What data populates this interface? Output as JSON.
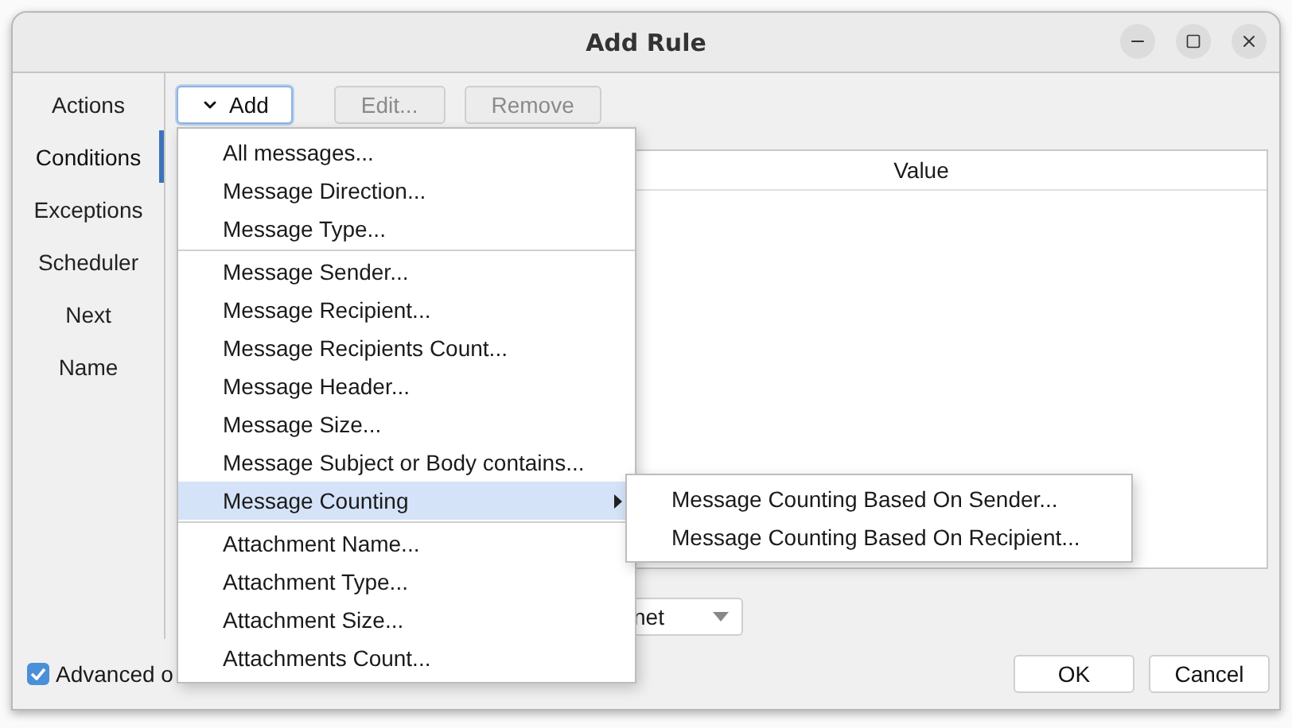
{
  "window": {
    "title": "Add Rule"
  },
  "nav": [
    {
      "label": "Actions",
      "selected": false
    },
    {
      "label": "Conditions",
      "selected": true
    },
    {
      "label": "Exceptions",
      "selected": false
    },
    {
      "label": "Scheduler",
      "selected": false
    },
    {
      "label": "Next",
      "selected": false
    },
    {
      "label": "Name",
      "selected": false
    }
  ],
  "toolbar": [
    {
      "label": "Add",
      "kind": "dropdown",
      "disabled": false,
      "focused": true
    },
    {
      "label": "Edit...",
      "kind": "plain",
      "disabled": true,
      "focused": false
    },
    {
      "label": "Remove",
      "kind": "plain",
      "disabled": true,
      "focused": false
    }
  ],
  "table": {
    "columns": [
      "Value"
    ]
  },
  "combo": {
    "value": "net"
  },
  "advanced": {
    "label": "Advanced o",
    "checked": true
  },
  "buttons": [
    "OK",
    "Cancel"
  ],
  "menu": {
    "groups": [
      [
        {
          "label": "All messages...",
          "selected": false,
          "submenu": false
        },
        {
          "label": "Message Direction...",
          "selected": false,
          "submenu": false
        },
        {
          "label": "Message Type...",
          "selected": false,
          "submenu": false
        }
      ],
      [
        {
          "label": "Message Sender...",
          "selected": false,
          "submenu": false
        },
        {
          "label": "Message Recipient...",
          "selected": false,
          "submenu": false
        },
        {
          "label": "Message Recipients Count...",
          "selected": false,
          "submenu": false
        },
        {
          "label": "Message Header...",
          "selected": false,
          "submenu": false
        },
        {
          "label": "Message Size...",
          "selected": false,
          "submenu": false
        },
        {
          "label": "Message Subject or Body contains...",
          "selected": false,
          "submenu": false
        },
        {
          "label": "Message Counting",
          "selected": true,
          "submenu": true
        }
      ],
      [
        {
          "label": "Attachment Name...",
          "selected": false,
          "submenu": false
        },
        {
          "label": "Attachment Type...",
          "selected": false,
          "submenu": false
        },
        {
          "label": "Attachment Size...",
          "selected": false,
          "submenu": false
        },
        {
          "label": "Attachments Count...",
          "selected": false,
          "submenu": false
        }
      ]
    ],
    "submenu": [
      {
        "label": "Message Counting Based On Sender...",
        "selected": false
      },
      {
        "label": "Message Counting Based On Recipient...",
        "selected": false
      }
    ]
  }
}
